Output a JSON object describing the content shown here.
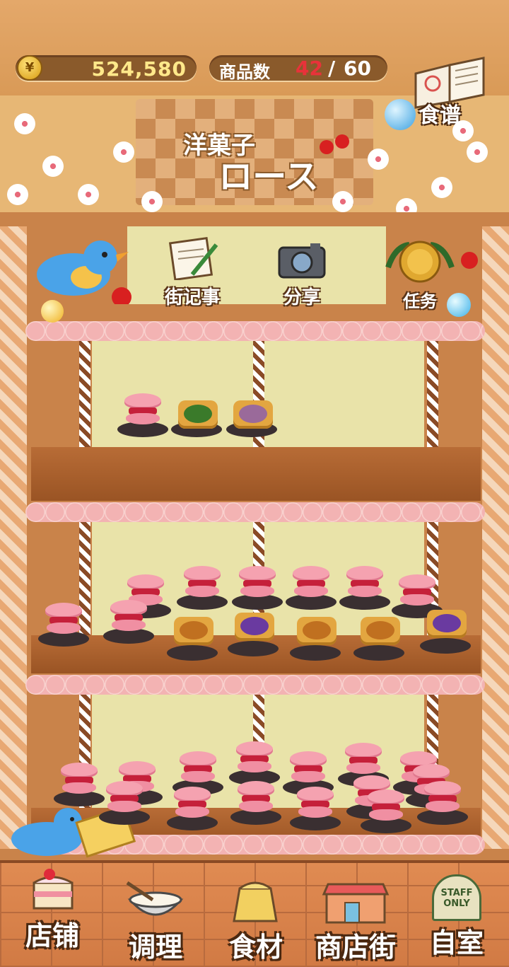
{
  "header": {
    "money": {
      "symbol": "¥",
      "value": "524,580"
    },
    "item_count": {
      "label": "商品数",
      "current": "42",
      "separator": "/",
      "max": "60"
    },
    "recipe": {
      "label": "食谱",
      "icon": "recipe-book-icon"
    }
  },
  "shop_sign": {
    "line1": "洋菓子",
    "line2": "ロース"
  },
  "actions": [
    {
      "label": "街记事",
      "icon": "notepad-icon"
    },
    {
      "label": "分享",
      "icon": "camera-icon"
    },
    {
      "label": "任务",
      "icon": "medal-icon"
    }
  ],
  "bottom_nav": [
    {
      "label": "店铺",
      "icon": "cake-icon"
    },
    {
      "label": "调理",
      "icon": "mixing-bowl-icon"
    },
    {
      "label": "食材",
      "icon": "flour-sack-icon"
    },
    {
      "label": "商店街",
      "icon": "storefront-icon"
    },
    {
      "label": "自室",
      "icon": "staff-door-icon",
      "sign_text": "STAFF ONLY"
    }
  ],
  "colors": {
    "accent_red": "#e8323a",
    "money_text": "#ffe88a",
    "frill_pink": "#f3b3b3"
  }
}
